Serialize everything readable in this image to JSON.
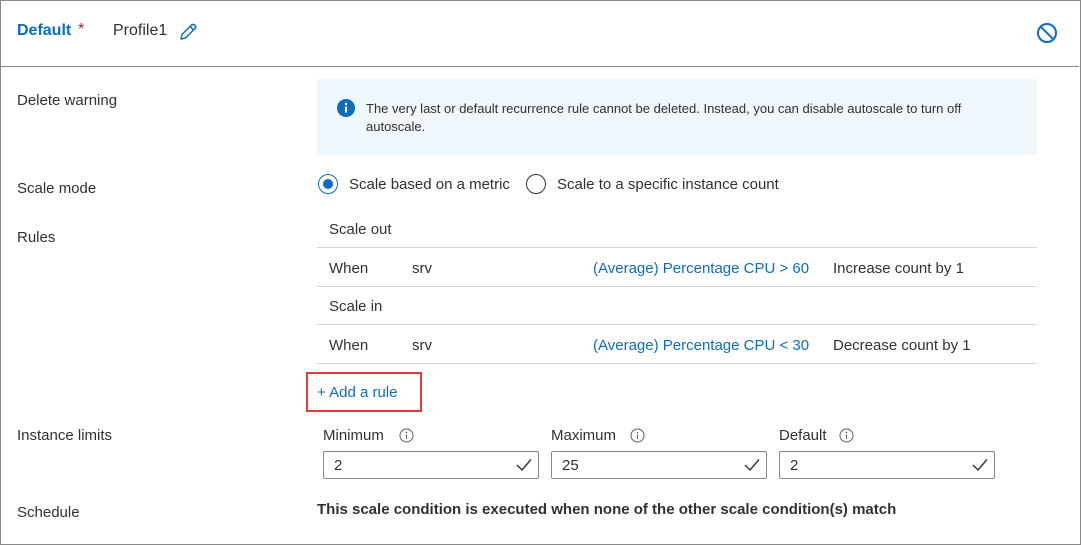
{
  "header": {
    "name": "Default",
    "required_mark": "*",
    "profile": "Profile1",
    "edit_icon": "pencil-icon",
    "disable_icon": "disable-icon",
    "accent_color": "#0f6cbd"
  },
  "labels": {
    "delete_warning": "Delete warning",
    "scale_mode": "Scale mode",
    "rules": "Rules",
    "instance_limits": "Instance limits",
    "schedule": "Schedule"
  },
  "info": {
    "icon": "info-icon",
    "text": "The very last or default recurrence rule cannot be deleted. Instead, you can disable autoscale to turn off autoscale."
  },
  "scale_mode": {
    "options": [
      {
        "label": "Scale based on a metric",
        "checked": true
      },
      {
        "label": "Scale to a specific instance count",
        "checked": false
      }
    ]
  },
  "rules": {
    "scale_out": {
      "title": "Scale out",
      "when": "When",
      "resource": "srv",
      "condition": "(Average) Percentage CPU > 60",
      "action": "Increase count by 1"
    },
    "scale_in": {
      "title": "Scale in",
      "when": "When",
      "resource": "srv",
      "condition": "(Average) Percentage CPU < 30",
      "action": "Decrease count by 1"
    },
    "add_rule": "+ Add a rule",
    "highlight_color": "#e33b3b"
  },
  "limits": {
    "minimum": {
      "label": "Minimum",
      "value": "2"
    },
    "maximum": {
      "label": "Maximum",
      "value": "25"
    },
    "default": {
      "label": "Default",
      "value": "2"
    }
  },
  "schedule": {
    "text": "This scale condition is executed when none of the other scale condition(s) match"
  }
}
